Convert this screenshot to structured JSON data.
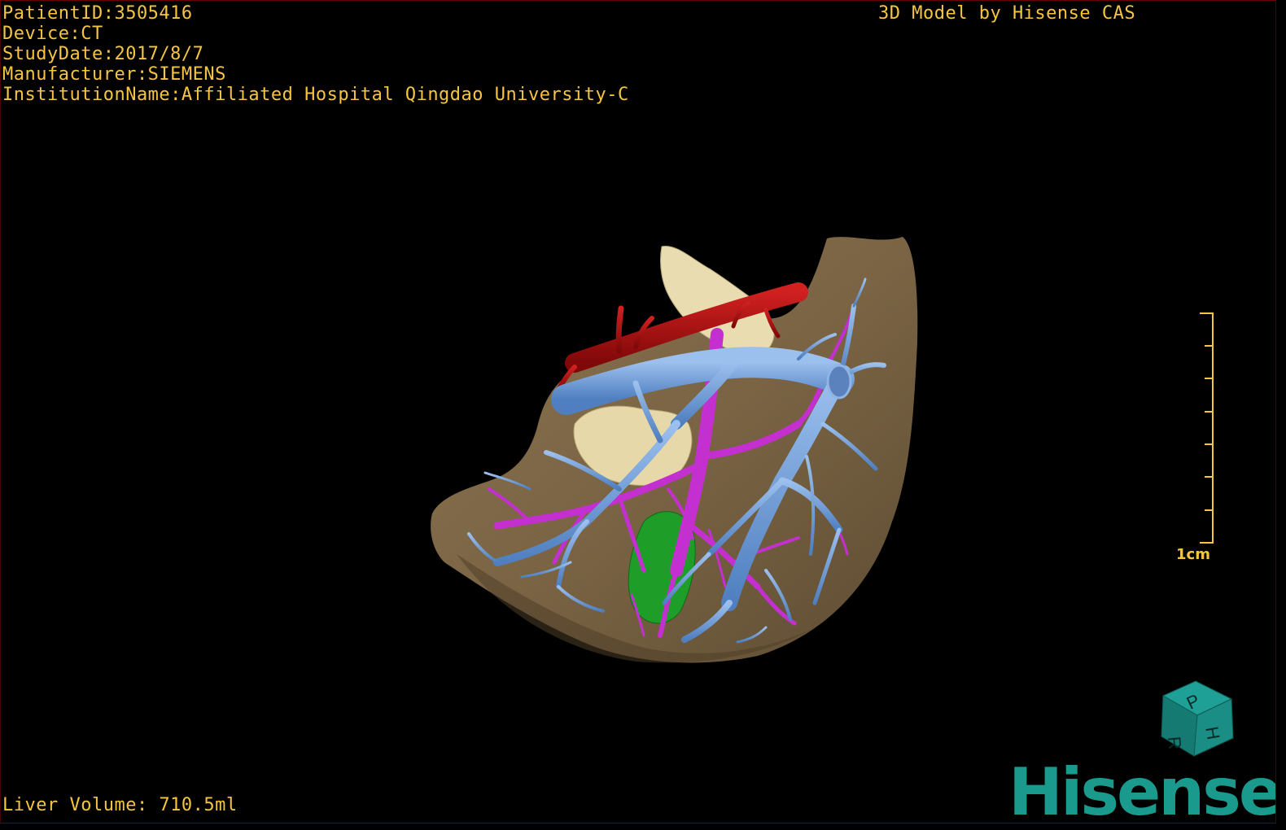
{
  "dicom": {
    "patient_id": "PatientID:3505416",
    "device": "Device:CT",
    "study_date": "StudyDate:2017/8/7",
    "manufacturer": "Manufacturer:SIEMENS",
    "institution": "InstitutionName:Affiliated Hospital Qingdao University-C"
  },
  "credit": "3D Model by Hisense CAS",
  "liver_volume": "Liver Volume: 710.5ml",
  "scale": {
    "label": "1cm"
  },
  "orientation_cube": {
    "face_top": "P",
    "face_side": "H",
    "face_front": "R"
  },
  "logo": "Hisense",
  "colors": {
    "overlay_text": "#f5c542",
    "liver": "#7a6444",
    "portal_vein": "#6b9bd8",
    "hepatic_vein": "#c42fd0",
    "artery": "#b01010",
    "bone": "#e8dcb0",
    "gallbladder": "#1e9e28",
    "logo": "#1a9a8c"
  }
}
